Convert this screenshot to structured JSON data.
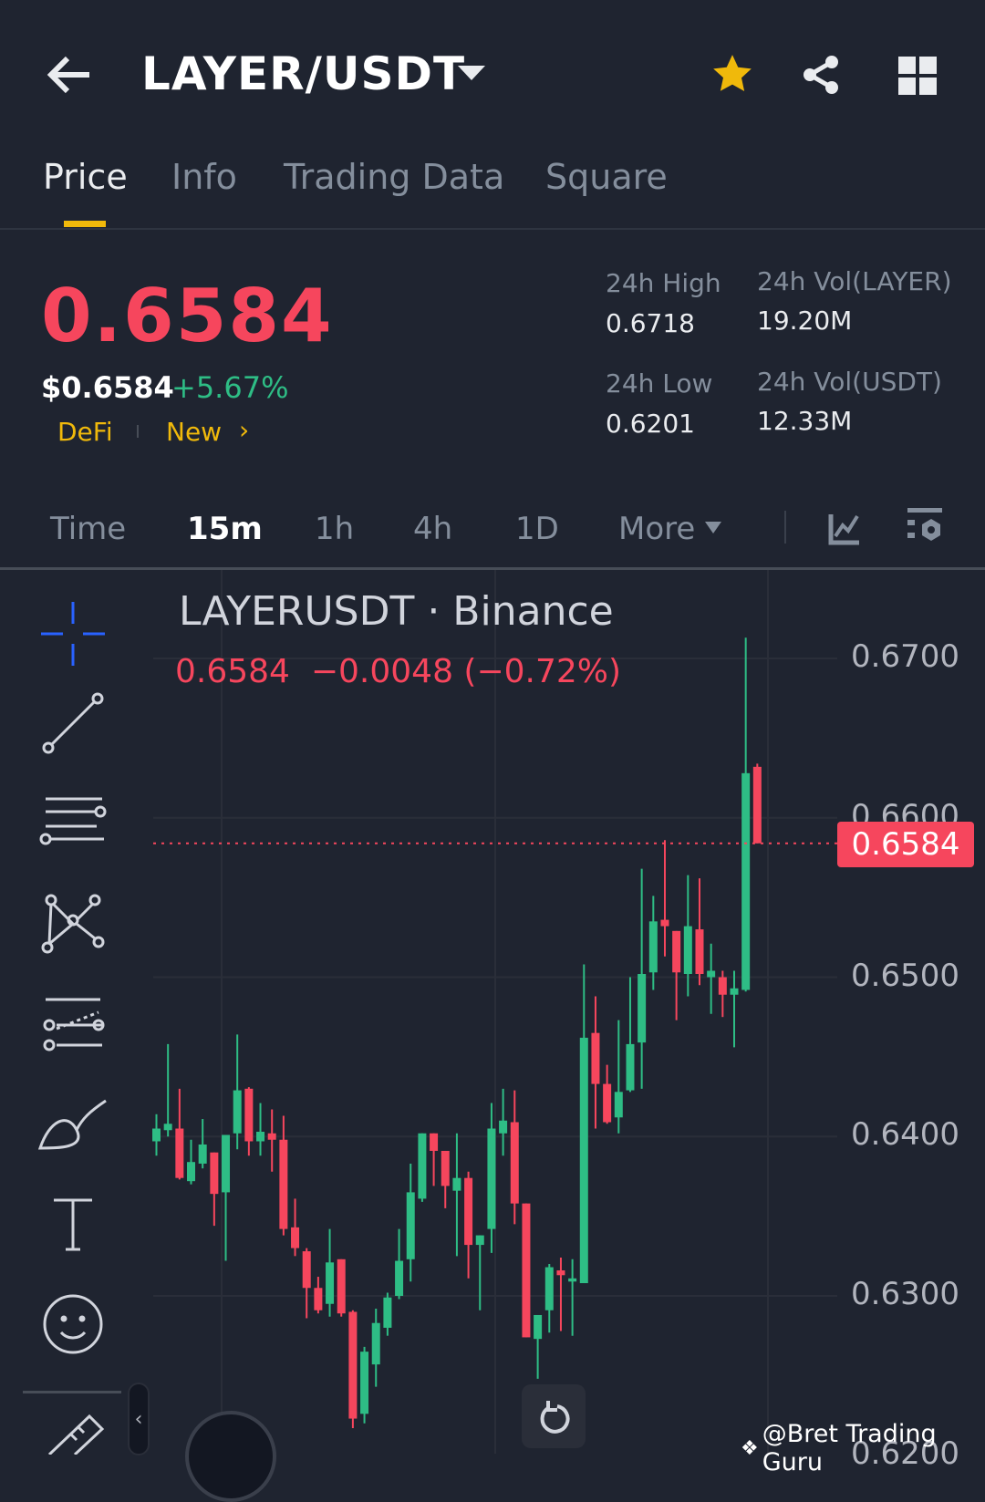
{
  "header": {
    "title": "LAYER/USDT"
  },
  "tabs": [
    {
      "label": "Price"
    },
    {
      "label": "Info"
    },
    {
      "label": "Trading Data"
    },
    {
      "label": "Square"
    }
  ],
  "ticker": {
    "last_price": "0.6584",
    "usd_price": "$0.6584",
    "change_pct": "+5.67%",
    "tags": [
      "DeFi",
      "New"
    ],
    "stats": [
      {
        "label": "24h High",
        "value": "0.6718"
      },
      {
        "label": "24h Vol(LAYER)",
        "value": "19.20M"
      },
      {
        "label": "24h Low",
        "value": "0.6201"
      },
      {
        "label": "24h Vol(USDT)",
        "value": "12.33M"
      }
    ]
  },
  "timeframes": [
    {
      "label": "Time"
    },
    {
      "label": "15m"
    },
    {
      "label": "1h"
    },
    {
      "label": "4h"
    },
    {
      "label": "1D"
    },
    {
      "label": "More"
    }
  ],
  "chart": {
    "symbol_title": "LAYERUSDT · Binance",
    "ohlc_line": "0.6584  −0.0048 (−0.72%)",
    "price_tag": "0.6584",
    "watermark": "@Bret Trading Guru"
  },
  "colors": {
    "up": "#2ebd85",
    "down": "#f6465d",
    "accent": "#f0b90b"
  },
  "chart_data": {
    "type": "candlestick",
    "interval": "15m",
    "y_ticks": [
      "0.6700",
      "0.6600",
      "0.6500",
      "0.6400",
      "0.6300",
      "0.6200"
    ],
    "ylim": [
      0.6185,
      0.6745
    ],
    "last_price": 0.6584,
    "ohlc": [
      [
        0.6397,
        0.6414,
        0.6388,
        0.6405
      ],
      [
        0.6404,
        0.6458,
        0.64,
        0.6408
      ],
      [
        0.6405,
        0.643,
        0.6373,
        0.6374
      ],
      [
        0.6372,
        0.6398,
        0.637,
        0.6384
      ],
      [
        0.6383,
        0.6411,
        0.638,
        0.6395
      ],
      [
        0.639,
        0.639,
        0.6344,
        0.6364
      ],
      [
        0.6365,
        0.6401,
        0.6322,
        0.6401
      ],
      [
        0.6402,
        0.6464,
        0.6392,
        0.6429
      ],
      [
        0.643,
        0.6431,
        0.6388,
        0.6397
      ],
      [
        0.6397,
        0.6421,
        0.6388,
        0.6403
      ],
      [
        0.6402,
        0.6417,
        0.6378,
        0.6398
      ],
      [
        0.6398,
        0.6413,
        0.6338,
        0.6342
      ],
      [
        0.6343,
        0.6361,
        0.6325,
        0.633
      ],
      [
        0.6328,
        0.633,
        0.6286,
        0.6305
      ],
      [
        0.6305,
        0.6312,
        0.6289,
        0.6291
      ],
      [
        0.6295,
        0.6342,
        0.6287,
        0.6321
      ],
      [
        0.6323,
        0.6323,
        0.6287,
        0.6289
      ],
      [
        0.629,
        0.6291,
        0.6217,
        0.6223
      ],
      [
        0.6226,
        0.6268,
        0.622,
        0.6265
      ],
      [
        0.6257,
        0.6292,
        0.6243,
        0.6283
      ],
      [
        0.628,
        0.6302,
        0.6275,
        0.6299
      ],
      [
        0.63,
        0.6342,
        0.6298,
        0.6322
      ],
      [
        0.6323,
        0.6383,
        0.6309,
        0.6365
      ],
      [
        0.6361,
        0.6402,
        0.6359,
        0.6402
      ],
      [
        0.6402,
        0.6402,
        0.6369,
        0.6391
      ],
      [
        0.6391,
        0.6391,
        0.6355,
        0.6369
      ],
      [
        0.6366,
        0.6402,
        0.6325,
        0.6374
      ],
      [
        0.6374,
        0.6378,
        0.6311,
        0.6332
      ],
      [
        0.6332,
        0.6338,
        0.6291,
        0.6338
      ],
      [
        0.6342,
        0.6421,
        0.6327,
        0.6405
      ],
      [
        0.6402,
        0.643,
        0.6388,
        0.641
      ],
      [
        0.6409,
        0.6429,
        0.6345,
        0.6358
      ],
      [
        0.6358,
        0.6358,
        0.6274,
        0.6274
      ],
      [
        0.6273,
        0.6288,
        0.6248,
        0.6288
      ],
      [
        0.6291,
        0.632,
        0.6277,
        0.6318
      ],
      [
        0.6316,
        0.6324,
        0.6278,
        0.6313
      ],
      [
        0.6309,
        0.6323,
        0.6275,
        0.6311
      ],
      [
        0.6308,
        0.6508,
        0.6308,
        0.6462
      ],
      [
        0.6465,
        0.6488,
        0.6405,
        0.6433
      ],
      [
        0.6433,
        0.6445,
        0.6408,
        0.6409
      ],
      [
        0.6412,
        0.6473,
        0.6402,
        0.6428
      ],
      [
        0.6429,
        0.65,
        0.6428,
        0.6458
      ],
      [
        0.6459,
        0.6568,
        0.643,
        0.6502
      ],
      [
        0.6503,
        0.6551,
        0.6492,
        0.6535
      ],
      [
        0.6536,
        0.6586,
        0.6513,
        0.6532
      ],
      [
        0.6529,
        0.6529,
        0.6473,
        0.6503
      ],
      [
        0.6502,
        0.6564,
        0.6488,
        0.6532
      ],
      [
        0.653,
        0.6562,
        0.6495,
        0.6502
      ],
      [
        0.65,
        0.6521,
        0.6477,
        0.6504
      ],
      [
        0.65,
        0.6504,
        0.6475,
        0.6489
      ],
      [
        0.6489,
        0.6504,
        0.6456,
        0.6493
      ],
      [
        0.6492,
        0.6713,
        0.6491,
        0.6628
      ],
      [
        0.6632,
        0.6634,
        0.6584,
        0.6584
      ]
    ]
  }
}
